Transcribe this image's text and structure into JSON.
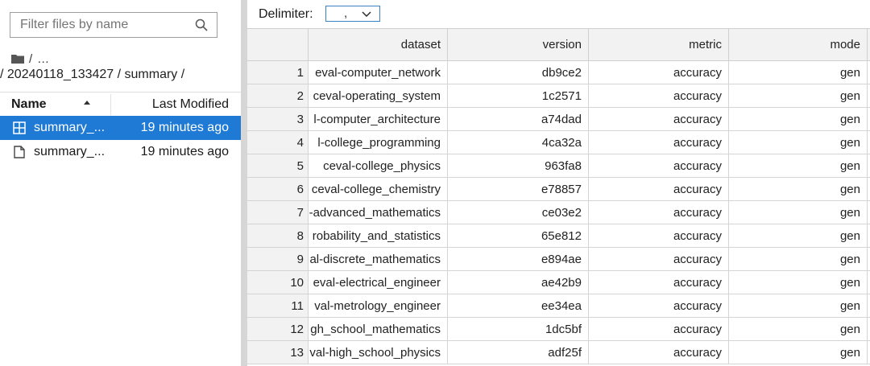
{
  "file_browser": {
    "filter_placeholder": "Filter files by name",
    "breadcrumb_root": "/",
    "breadcrumb_ellipsis": "…",
    "breadcrumb_path": "/ 20240118_133427 / summary /",
    "column_name": "Name",
    "column_modified": "Last Modified",
    "files": [
      {
        "name": "summary_...",
        "modified": "19 minutes ago",
        "icon": "table-file-icon",
        "selected": true
      },
      {
        "name": "summary_...",
        "modified": "19 minutes ago",
        "icon": "document-file-icon",
        "selected": false
      }
    ]
  },
  "csv_viewer": {
    "delimiter_label": "Delimiter:",
    "delimiter_value": ",",
    "columns": [
      "dataset",
      "version",
      "metric",
      "mode"
    ],
    "rows": [
      {
        "n": "1",
        "dataset": "eval-computer_network",
        "version": "db9ce2",
        "metric": "accuracy",
        "mode": "gen"
      },
      {
        "n": "2",
        "dataset": "ceval-operating_system",
        "version": "1c2571",
        "metric": "accuracy",
        "mode": "gen"
      },
      {
        "n": "3",
        "dataset": "l-computer_architecture",
        "version": "a74dad",
        "metric": "accuracy",
        "mode": "gen"
      },
      {
        "n": "4",
        "dataset": "l-college_programming",
        "version": "4ca32a",
        "metric": "accuracy",
        "mode": "gen"
      },
      {
        "n": "5",
        "dataset": "ceval-college_physics",
        "version": "963fa8",
        "metric": "accuracy",
        "mode": "gen"
      },
      {
        "n": "6",
        "dataset": "ceval-college_chemistry",
        "version": "e78857",
        "metric": "accuracy",
        "mode": "gen"
      },
      {
        "n": "7",
        "dataset": "-advanced_mathematics",
        "version": "ce03e2",
        "metric": "accuracy",
        "mode": "gen"
      },
      {
        "n": "8",
        "dataset": "robability_and_statistics",
        "version": "65e812",
        "metric": "accuracy",
        "mode": "gen"
      },
      {
        "n": "9",
        "dataset": "al-discrete_mathematics",
        "version": "e894ae",
        "metric": "accuracy",
        "mode": "gen"
      },
      {
        "n": "10",
        "dataset": "eval-electrical_engineer",
        "version": "ae42b9",
        "metric": "accuracy",
        "mode": "gen"
      },
      {
        "n": "11",
        "dataset": "val-metrology_engineer",
        "version": "ee34ea",
        "metric": "accuracy",
        "mode": "gen"
      },
      {
        "n": "12",
        "dataset": "gh_school_mathematics",
        "version": "1dc5bf",
        "metric": "accuracy",
        "mode": "gen"
      },
      {
        "n": "13",
        "dataset": "val-high_school_physics",
        "version": "adf25f",
        "metric": "accuracy",
        "mode": "gen"
      }
    ]
  },
  "colors": {
    "selection": "#1e7ad4",
    "select_border": "#3b82c4",
    "header_bg": "#f2f2f2"
  }
}
